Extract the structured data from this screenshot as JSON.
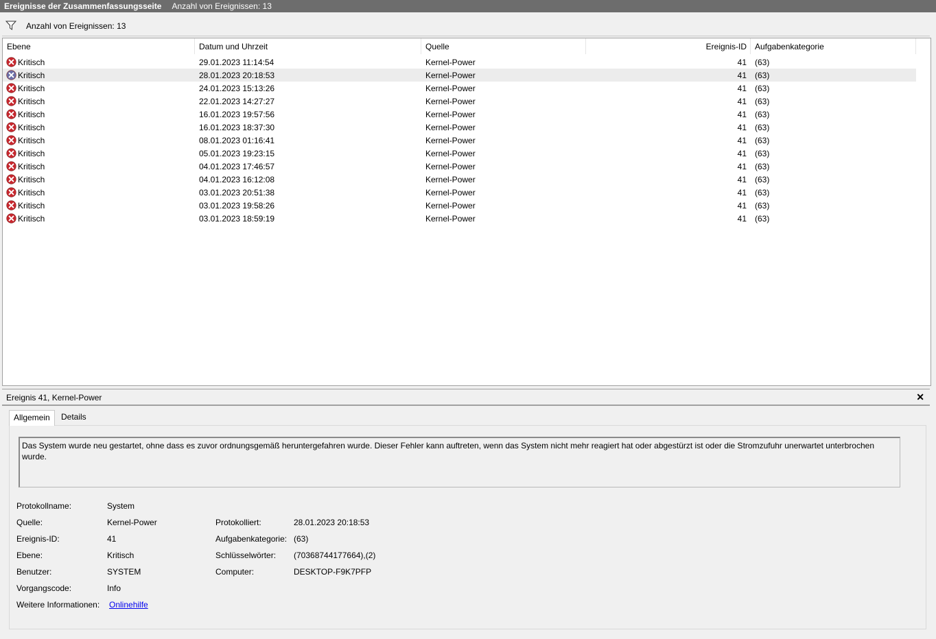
{
  "titlebar": {
    "title": "Ereignisse der Zusammenfassungsseite",
    "count": "Anzahl von Ereignissen: 13"
  },
  "filterbar": {
    "count": "Anzahl von Ereignissen: 13"
  },
  "columns": {
    "level": "Ebene",
    "datetime": "Datum und Uhrzeit",
    "source": "Quelle",
    "event_id": "Ereignis-ID",
    "category": "Aufgabenkategorie"
  },
  "events": [
    {
      "level": "Kritisch",
      "datetime": "29.01.2023 11:14:54",
      "source": "Kernel-Power",
      "event_id": "41",
      "category": "(63)"
    },
    {
      "level": "Kritisch",
      "datetime": "28.01.2023 20:18:53",
      "source": "Kernel-Power",
      "event_id": "41",
      "category": "(63)"
    },
    {
      "level": "Kritisch",
      "datetime": "24.01.2023 15:13:26",
      "source": "Kernel-Power",
      "event_id": "41",
      "category": "(63)"
    },
    {
      "level": "Kritisch",
      "datetime": "22.01.2023 14:27:27",
      "source": "Kernel-Power",
      "event_id": "41",
      "category": "(63)"
    },
    {
      "level": "Kritisch",
      "datetime": "16.01.2023 19:57:56",
      "source": "Kernel-Power",
      "event_id": "41",
      "category": "(63)"
    },
    {
      "level": "Kritisch",
      "datetime": "16.01.2023 18:37:30",
      "source": "Kernel-Power",
      "event_id": "41",
      "category": "(63)"
    },
    {
      "level": "Kritisch",
      "datetime": "08.01.2023 01:16:41",
      "source": "Kernel-Power",
      "event_id": "41",
      "category": "(63)"
    },
    {
      "level": "Kritisch",
      "datetime": "05.01.2023 19:23:15",
      "source": "Kernel-Power",
      "event_id": "41",
      "category": "(63)"
    },
    {
      "level": "Kritisch",
      "datetime": "04.01.2023 17:46:57",
      "source": "Kernel-Power",
      "event_id": "41",
      "category": "(63)"
    },
    {
      "level": "Kritisch",
      "datetime": "04.01.2023 16:12:08",
      "source": "Kernel-Power",
      "event_id": "41",
      "category": "(63)"
    },
    {
      "level": "Kritisch",
      "datetime": "03.01.2023 20:51:38",
      "source": "Kernel-Power",
      "event_id": "41",
      "category": "(63)"
    },
    {
      "level": "Kritisch",
      "datetime": "03.01.2023 19:58:26",
      "source": "Kernel-Power",
      "event_id": "41",
      "category": "(63)"
    },
    {
      "level": "Kritisch",
      "datetime": "03.01.2023 18:59:19",
      "source": "Kernel-Power",
      "event_id": "41",
      "category": "(63)"
    }
  ],
  "selected_index": 1,
  "detail": {
    "title": "Ereignis 41, Kernel-Power",
    "tabs": [
      "Allgemein",
      "Details"
    ],
    "description": "Das System wurde neu gestartet, ohne dass es zuvor ordnungsgemäß heruntergefahren wurde. Dieser Fehler kann auftreten, wenn das System nicht mehr reagiert hat oder abgestürzt ist oder die Stromzufuhr unerwartet unterbrochen wurde.",
    "labels": {
      "log_name": "Protokollname:",
      "source": "Quelle:",
      "event_id": "Ereignis-ID:",
      "level": "Ebene:",
      "user": "Benutzer:",
      "opcode": "Vorgangscode:",
      "more_info": "Weitere Informationen:",
      "logged": "Protokolliert:",
      "task_category": "Aufgabenkategorie:",
      "keywords": "Schlüsselwörter:",
      "computer": "Computer:"
    },
    "values": {
      "log_name": "System",
      "source": "Kernel-Power",
      "event_id": "41",
      "level": "Kritisch",
      "user": "SYSTEM",
      "opcode": "Info",
      "more_info": "Onlinehilfe",
      "logged": "28.01.2023 20:18:53",
      "task_category": "(63)",
      "keywords": "(70368744177664),(2)",
      "computer": "DESKTOP-F9K7PFP"
    }
  },
  "colors": {
    "titlebar": "#6d6d6d",
    "critical_icon": "#c8272e",
    "critical_icon_selected": "#6b6fa8",
    "link": "#0000ee"
  }
}
